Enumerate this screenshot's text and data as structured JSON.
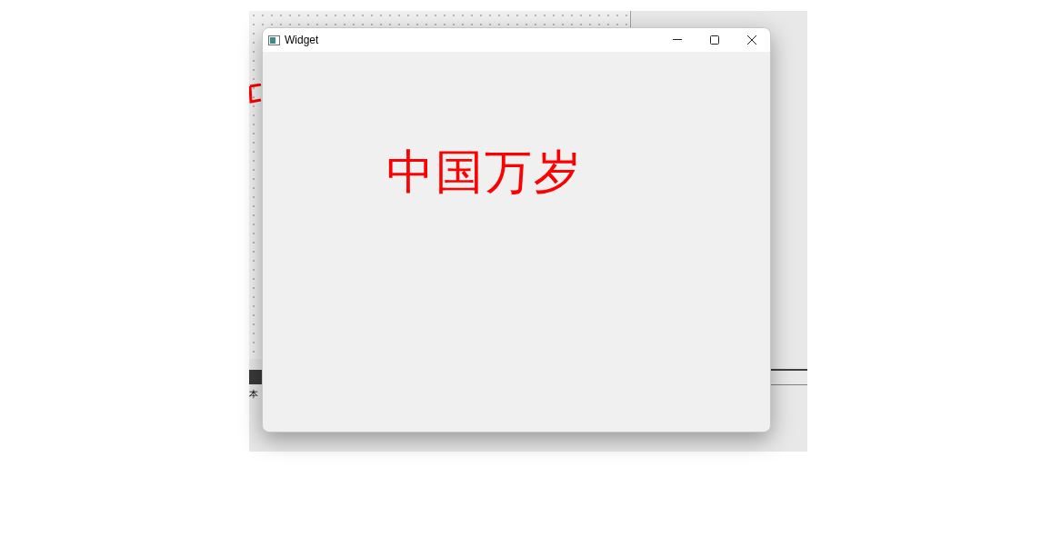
{
  "background_editor": {
    "label_fragment": "本"
  },
  "window": {
    "title": "Widget",
    "controls": [
      {
        "kind": "minimize"
      },
      {
        "kind": "maximize"
      },
      {
        "kind": "close"
      }
    ]
  },
  "content": {
    "text": "中国万岁",
    "color": "#ff0000"
  }
}
